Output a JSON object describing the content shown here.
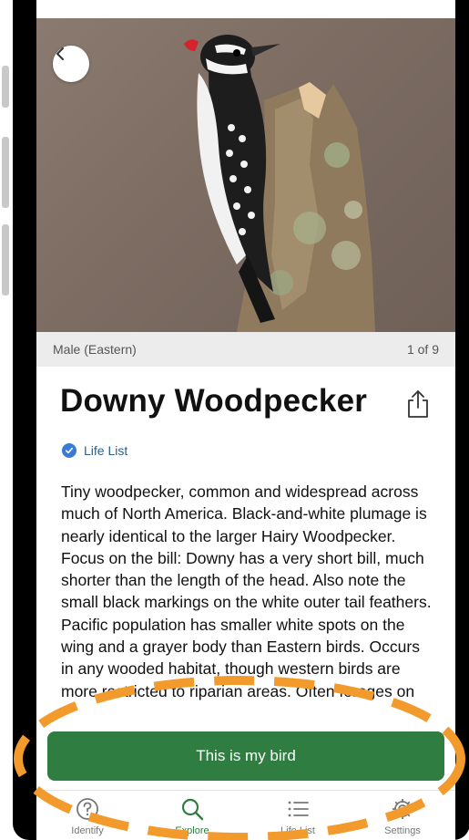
{
  "species": {
    "name": "Downy Woodpecker",
    "photo_caption": "Male (Eastern)",
    "photo_counter": "1 of 9",
    "life_list_label": "Life List",
    "description": "Tiny woodpecker, common and widespread across much of North America. Black-and-white plumage is nearly identical to the larger Hairy Woodpecker. Focus on the bill: Downy has a very short bill, much shorter than the length of the head. Also note the small black markings on the white outer tail feathers. Pacific population has smaller white spots on the wing and a grayer body than Eastern birds. Occurs in any wooded habitat, though western birds are more restricted to riparian areas. Often forages on"
  },
  "actions": {
    "primary_label": "This is my bird"
  },
  "tabs": [
    {
      "label": "Identify",
      "icon": "question-circle-icon",
      "active": false
    },
    {
      "label": "Explore",
      "icon": "search-icon",
      "active": true
    },
    {
      "label": "Life List",
      "icon": "list-icon",
      "active": false
    },
    {
      "label": "Settings",
      "icon": "gear-icon",
      "active": false
    }
  ],
  "colors": {
    "primary_green": "#2f7d41",
    "life_list_blue": "#3a7bd5",
    "annotation_orange": "#f39a2d"
  }
}
